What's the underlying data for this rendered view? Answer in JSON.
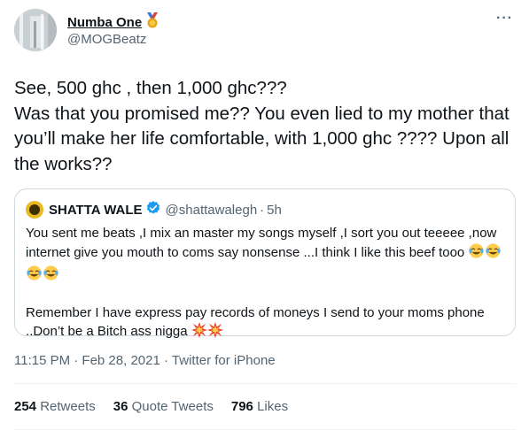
{
  "author": {
    "display_name": "Numba One",
    "handle": "@MOGBeatz",
    "badge_icon": "medal-icon",
    "avatar_icon": "avatar-photo"
  },
  "tweet_text": [
    "See, 500 ghc , then 1,000 ghc???",
    "Was that you promised me?? You even lied to my mother that you’ll make her life comfortable, with 1,000 ghc ???? Upon all the works??"
  ],
  "quoted": {
    "display_name": "SHATTA WALE",
    "handle": "@shattawalegh",
    "separator": "·",
    "time": "5h",
    "paragraph1": "You sent me beats ,I mix an master my songs myself ,I sort you out teeeee ,now internet give you mouth to coms say nonsense ...I think I like this beef tooo",
    "paragraph2": "Remember I have express pay records of moneys I send to your moms phone ..Don’t be a Bitch ass nigga",
    "emoji_laugh": "joy-emoji",
    "emoji_burst": "collision-emoji"
  },
  "meta": {
    "timestamp": "11:15 PM · Feb 28, 2021",
    "separator": "·",
    "source": "Twitter for iPhone"
  },
  "stats": {
    "retweets_count": "254",
    "retweets_label": "Retweets",
    "quotes_count": "36",
    "quotes_label": "Quote Tweets",
    "likes_count": "796",
    "likes_label": "Likes"
  },
  "more_label": "···",
  "colors": {
    "text": "#0f1419",
    "secondary": "#536471",
    "border": "#cfd9de",
    "verified": "#1d9bf0"
  }
}
